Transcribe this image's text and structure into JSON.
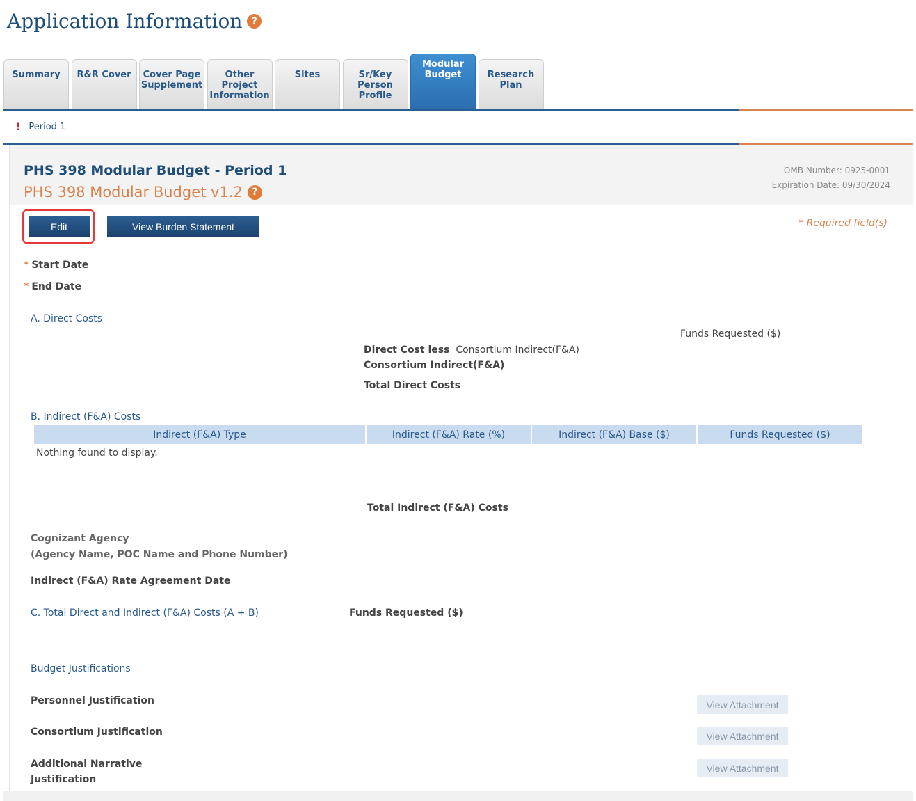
{
  "page": {
    "title": "Application Information",
    "help_icon": "?"
  },
  "tabs": [
    {
      "label": "Summary",
      "active": false
    },
    {
      "label": "R&R Cover",
      "active": false
    },
    {
      "label": "Cover Page Supplement",
      "active": false
    },
    {
      "label": "Other Project Information",
      "active": false
    },
    {
      "label": "Sites",
      "active": false
    },
    {
      "label": "Sr/Key Person Profile",
      "active": false
    },
    {
      "label": "Modular Budget",
      "active": true
    },
    {
      "label": "Research Plan",
      "active": false
    }
  ],
  "period": {
    "marker": "!",
    "label": "Period 1"
  },
  "form": {
    "title": "PHS 398 Modular Budget - Period 1",
    "version": "PHS 398 Modular Budget v1.2",
    "help_icon": "?",
    "omb_number": "OMB Number: 0925-0001",
    "expiration": "Expiration Date: 09/30/2024",
    "required_note": "* Required field(s)"
  },
  "buttons": {
    "edit": "Edit",
    "burden": "View Burden Statement"
  },
  "fields": {
    "required_marker": "*",
    "start_date": "Start Date",
    "end_date": "End Date"
  },
  "direct_costs": {
    "heading": "A. Direct Costs",
    "funds_header": "Funds Requested ($)",
    "less_label": "Direct Cost less",
    "less_suffix": "Consortium Indirect(F&A)",
    "consortium": "Consortium Indirect(F&A)",
    "total": "Total Direct Costs"
  },
  "indirect_costs": {
    "heading": "B. Indirect (F&A) Costs",
    "columns": [
      "Indirect (F&A) Type",
      "Indirect (F&A) Rate (%)",
      "Indirect (F&A) Base ($)",
      "Funds Requested ($)"
    ],
    "empty": "Nothing found to display.",
    "total": "Total Indirect (F&A) Costs",
    "cognizant_line1": "Cognizant Agency",
    "cognizant_line2": "(Agency Name, POC Name and Phone Number)",
    "rate_agreement": "Indirect (F&A) Rate Agreement Date"
  },
  "total_costs": {
    "heading": "C. Total Direct and Indirect (F&A) Costs (A + B)",
    "funds": "Funds Requested ($)"
  },
  "justifications": {
    "heading": "Budget Justifications",
    "personnel": "Personnel Justification",
    "consortium": "Consortium Justification",
    "additional_line1": "Additional Narrative",
    "additional_line2": "Justification",
    "view_label": "View Attachment"
  }
}
